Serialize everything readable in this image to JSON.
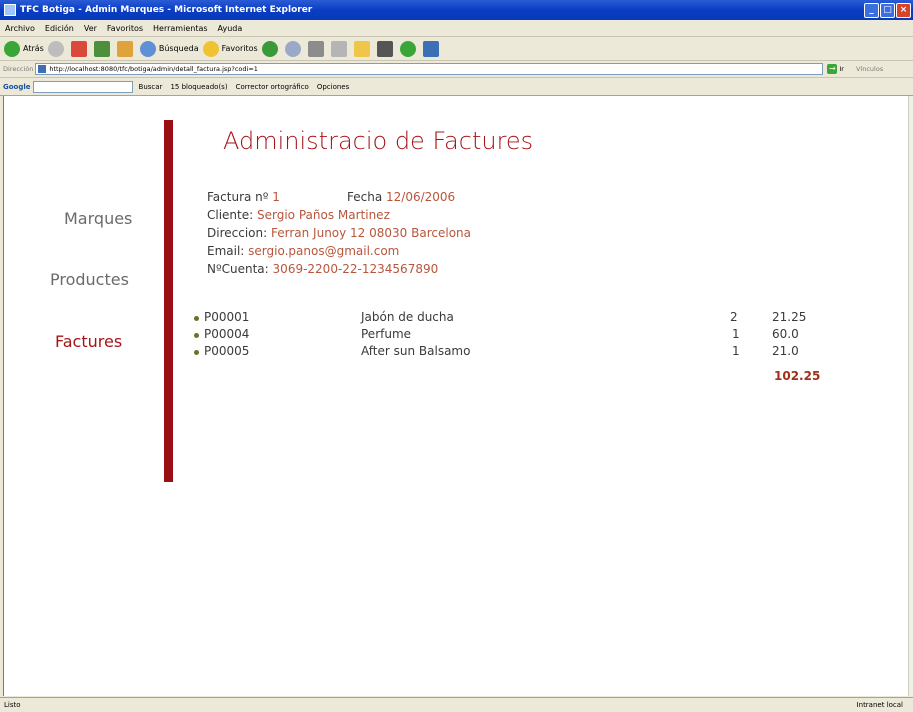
{
  "window": {
    "title": "TFC Botiga - Admin Marques - Microsoft Internet Explorer"
  },
  "menu": [
    "Archivo",
    "Edición",
    "Ver",
    "Favoritos",
    "Herramientas",
    "Ayuda"
  ],
  "toolbar": {
    "back": "Atrás",
    "search": "Búsqueda",
    "favorites": "Favoritos"
  },
  "address": {
    "label": "Dirección",
    "url": "http://localhost:8080/tfc/botiga/admin/detall_factura.jsp?codi=1",
    "go": "Ir",
    "links": "Vínculos"
  },
  "google": {
    "logo": "Google",
    "search": "Buscar",
    "blocked": "15 bloqueado(s)",
    "spell": "Corrector ortográfico",
    "options": "Opciones"
  },
  "status": {
    "text": "Listo",
    "zone": "Intranet local"
  },
  "nav": {
    "marques": "Marques",
    "productes": "Productes",
    "factures": "Factures"
  },
  "page": {
    "title": "Administracio de Factures"
  },
  "invoice": {
    "number_label": "Factura nº",
    "number": "1",
    "date_label": "Fecha",
    "date": "12/06/2006",
    "client_label": "Cliente:",
    "client": "Sergio Paños Martinez",
    "address_label": "Direccion:",
    "address": "Ferran Junoy 12 08030 Barcelona",
    "email_label": "Email:",
    "email": "sergio.panos@gmail.com",
    "account_label": "NºCuenta:",
    "account": "3069-2200-22-1234567890"
  },
  "items": [
    {
      "code": "P00001",
      "name": "Jabón de ducha",
      "qty": "2",
      "price": "21.25"
    },
    {
      "code": "P00004",
      "name": "Perfume",
      "qty": "1",
      "price": "60.0"
    },
    {
      "code": "P00005",
      "name": "After sun Balsamo",
      "qty": "1",
      "price": "21.0"
    }
  ],
  "total": "102.25"
}
